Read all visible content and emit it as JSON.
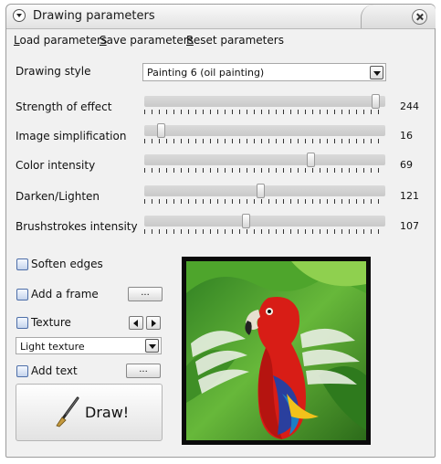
{
  "window": {
    "title": "Drawing parameters"
  },
  "menu": {
    "load": {
      "mnemonic": "L",
      "rest": "oad parameters"
    },
    "save": {
      "mnemonic": "S",
      "rest": "ave parameters"
    },
    "reset": {
      "mnemonic": "R",
      "rest": "eset parameters"
    }
  },
  "drawing_style": {
    "label": "Drawing style",
    "value": "Painting 6 (oil painting)"
  },
  "sliders": [
    {
      "label": "Strength of effect",
      "value": "244",
      "fraction": 0.96
    },
    {
      "label": "Image simplification",
      "value": "16",
      "fraction": 0.07
    },
    {
      "label": "Color intensity",
      "value": "69",
      "fraction": 0.69
    },
    {
      "label": "Darken/Lighten",
      "value": "121",
      "fraction": 0.48
    },
    {
      "label": "Brushstrokes intensity",
      "value": "107",
      "fraction": 0.42
    }
  ],
  "options": {
    "soften_edges": {
      "label": "Soften edges",
      "checked": false
    },
    "add_frame": {
      "label": "Add a frame",
      "checked": false,
      "button": "..."
    },
    "texture": {
      "label": "Texture",
      "checked": false
    },
    "texture_select": {
      "value": "Light texture"
    },
    "add_text": {
      "label": "Add text",
      "checked": false,
      "button": "..."
    }
  },
  "draw_button": {
    "label": "Draw!"
  },
  "icons": [
    "window-menu-icon",
    "close-icon",
    "dropdown-arrow-icon",
    "prev-arrow-icon",
    "next-arrow-icon",
    "paintbrush-icon"
  ],
  "colors": {
    "window_bg": "#f1f1f1",
    "checkbox_border": "#4d6ea8",
    "parrot_red": "#d81d16",
    "foliage_green": "#3a9a1f"
  }
}
